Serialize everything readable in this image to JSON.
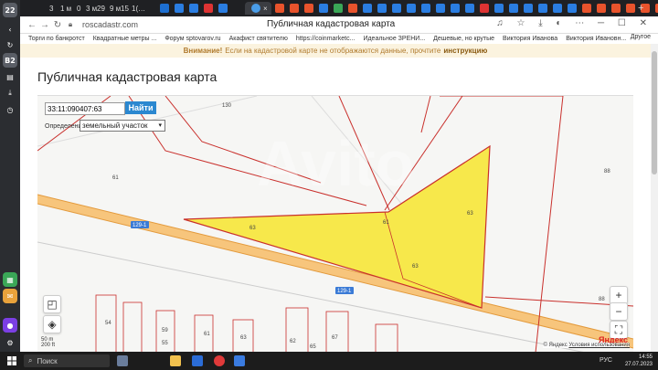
{
  "rail": {
    "counter": "22",
    "badge": "B2"
  },
  "tabs": [
    {
      "label": "3"
    },
    {
      "label": "1 м"
    },
    {
      "label": "0"
    },
    {
      "label": "3 м"
    },
    {
      "label": "29"
    },
    {
      "label": "9 м"
    },
    {
      "label": "15"
    },
    {
      "label": "1(…"
    }
  ],
  "browser": {
    "url": "roscadastr.com",
    "title": "Публичная кадастровая карта",
    "other_bookmarks": "Другое"
  },
  "bookmarks": [
    "Торги по банкротст",
    "Квадратные метры ...",
    "Форум sptovarov.ru",
    "Акафист святителю",
    "https://coinmarketc...",
    "Идеальное ЗРЕНИ...",
    "Дешевые, но крутые",
    "Виктория Иванова",
    "Виктория Ивановн..."
  ],
  "warning": {
    "strong": "Внимание!",
    "text": "Если на кадастровой карте не отображаются данные, прочтите",
    "link": "инструкцию"
  },
  "page": {
    "heading": "Публичная кадастровая карта"
  },
  "search": {
    "value": "33:11:090407:63",
    "button": "Найти"
  },
  "definition": {
    "label": "Определение",
    "selected": "земельный участок"
  },
  "map": {
    "labels": [
      "130",
      "61",
      "88",
      "63",
      "61",
      "63",
      "88",
      "63"
    ],
    "road_labels": [
      "129-1",
      "129-1"
    ],
    "house_numbers": [
      "54",
      "59",
      "55",
      "61",
      "63",
      "67",
      "62",
      "65"
    ],
    "scale_m": "50 m",
    "scale_ft": "200 ft",
    "attribution": "© Яндекс",
    "terms": "Условия использования",
    "logo": "Яндекс",
    "zoom_in": "+",
    "zoom_out": "−"
  },
  "taskbar": {
    "search": "Поиск",
    "lang": "РУС",
    "time": "14:55",
    "date": "27.07.2023"
  },
  "colors": {
    "parcel": "#f7e84b",
    "boundary": "#c9302c",
    "road": "#f2b05a",
    "button": "#2b88d0"
  }
}
